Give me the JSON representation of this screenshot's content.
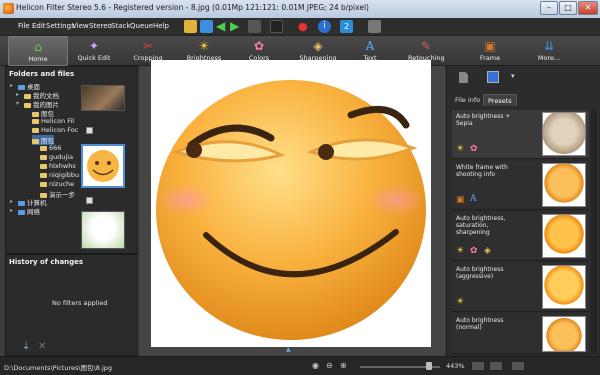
{
  "window": {
    "title": "Helicon Filter Stereo 5.6 - Registered version - 8.jpg (0.01Mp 121:121: 0.01M JPEG; 24 b/pixel)",
    "min": "–",
    "max": "□",
    "close": "✕"
  },
  "menu": [
    "File",
    "Edit",
    "Settings",
    "View",
    "Stereo",
    "Stack",
    "Queue",
    "Help"
  ],
  "ribbon": [
    {
      "label": "Home",
      "icon": "⌂"
    },
    {
      "label": "Quick Edit",
      "icon": "✦"
    },
    {
      "label": "Cropping",
      "icon": "✂"
    },
    {
      "label": "Brightness",
      "icon": "☀"
    },
    {
      "label": "Colors",
      "icon": "✿"
    },
    {
      "label": "Sharpening",
      "icon": "◈"
    },
    {
      "label": "Text",
      "icon": "A"
    },
    {
      "label": "Retouching",
      "icon": "✎"
    },
    {
      "label": "Frame",
      "icon": "▣"
    },
    {
      "label": "More...",
      "icon": "⇊"
    }
  ],
  "left": {
    "folders_title": "Folders and files",
    "tree": [
      "桌面",
      "我的文档",
      "我的图片",
      "图包",
      "Helicon Fil",
      "Helicon Foc",
      "图包",
      "666",
      "gudujia",
      "hlxhwhs",
      "niqigibbu",
      "nizuche",
      "演示一步",
      "计算机",
      "网络"
    ],
    "history_title": "History of changes",
    "history_empty": "No filters applied"
  },
  "right": {
    "tab_info": "File info",
    "tab_presets": "Presets",
    "presets": [
      "Auto brightness + Sepia",
      "White frame with shooting info",
      "Auto brightness, saturation, sharpening",
      "Auto brightness (aggressive)",
      "Auto brightness (normal)"
    ]
  },
  "status": {
    "path": "D:\\Documents\\Pictures\\图包\\8.jpg",
    "zoom": "443%"
  }
}
